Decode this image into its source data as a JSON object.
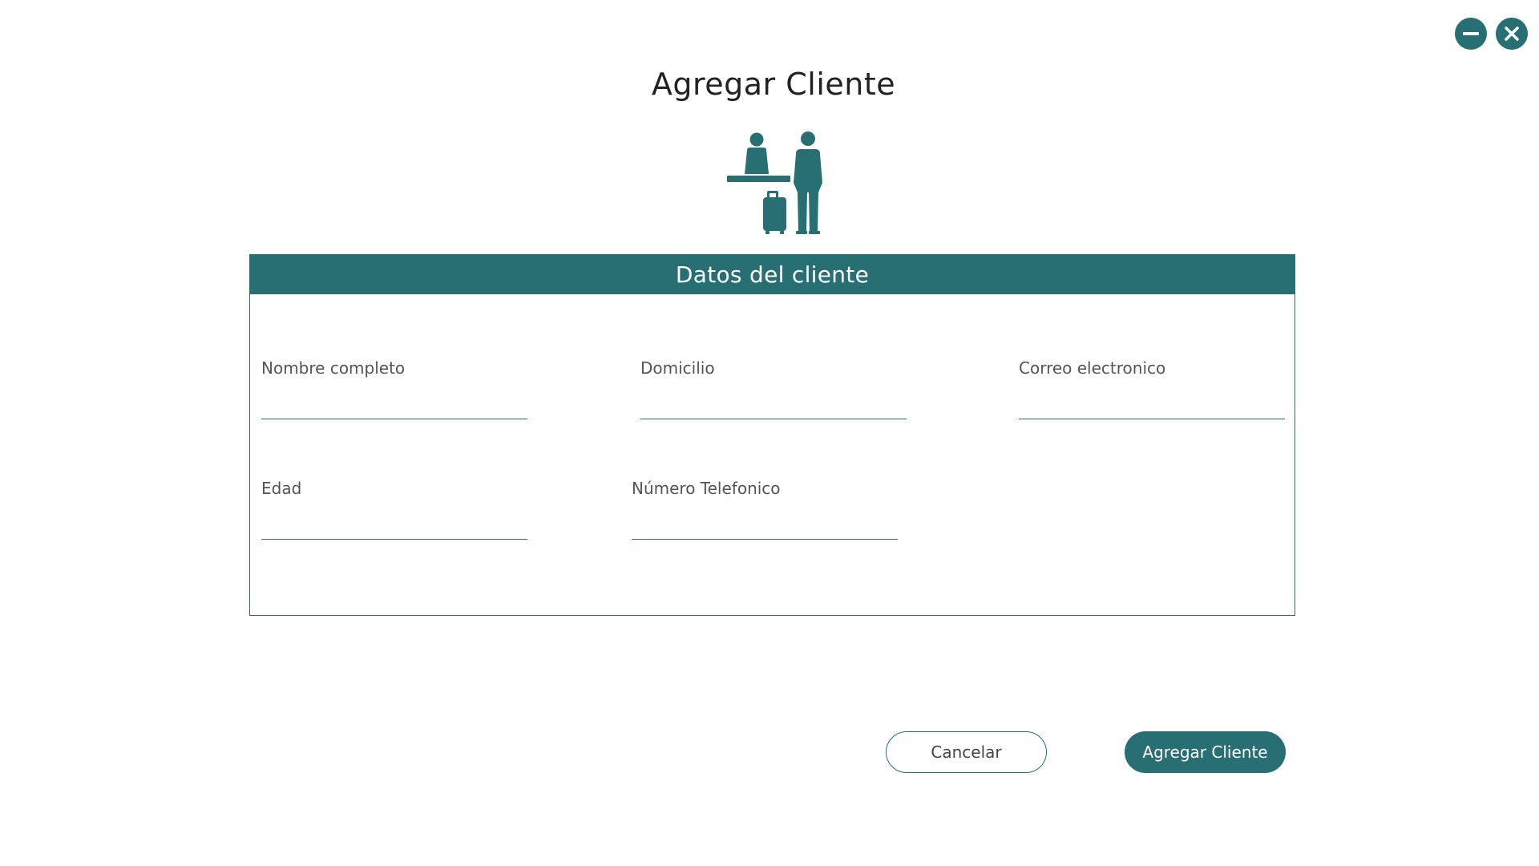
{
  "window_controls": {
    "minimize": "minimize",
    "close": "close"
  },
  "title": "Agregar Cliente",
  "section": {
    "header": "Datos del cliente"
  },
  "fields": {
    "nombre": {
      "label": "Nombre completo",
      "value": ""
    },
    "domicilio": {
      "label": "Domicilio",
      "value": ""
    },
    "correo": {
      "label": "Correo electronico",
      "value": ""
    },
    "edad": {
      "label": "Edad",
      "value": ""
    },
    "telefono": {
      "label": "Número Telefonico",
      "value": ""
    }
  },
  "actions": {
    "cancel_label": "Cancelar",
    "submit_label": "Agregar Cliente"
  },
  "colors": {
    "accent": "#276f72",
    "background": "#ffffff"
  },
  "icons": {
    "hero": "hotel-reception-icon",
    "minimize": "minimize-icon",
    "close": "close-icon"
  }
}
